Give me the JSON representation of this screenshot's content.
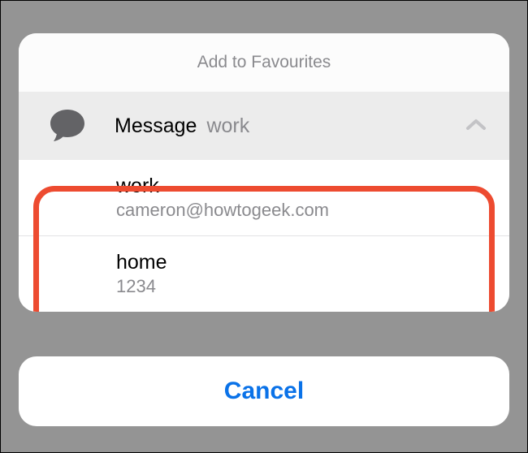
{
  "sheet": {
    "title": "Add to Favourites",
    "category": {
      "icon": "message-bubble-icon",
      "label": "Message",
      "sublabel": "work"
    },
    "options": [
      {
        "label": "work",
        "value": "cameron@howtogeek.com"
      },
      {
        "label": "home",
        "value": "1234"
      }
    ]
  },
  "cancel": {
    "label": "Cancel"
  }
}
